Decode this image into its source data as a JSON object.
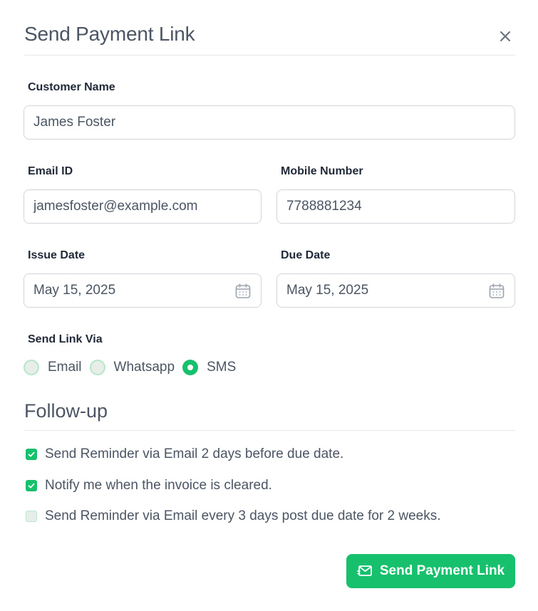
{
  "modal": {
    "title": "Send Payment Link",
    "close_icon": "close-icon"
  },
  "form": {
    "customer_name": {
      "label": "Customer Name",
      "value": "James Foster"
    },
    "email": {
      "label": "Email ID",
      "value": "jamesfoster@example.com"
    },
    "mobile": {
      "label": "Mobile Number",
      "value": "7788881234"
    },
    "issue_date": {
      "label": "Issue Date",
      "value": "May 15, 2025",
      "icon": "calendar-icon"
    },
    "due_date": {
      "label": "Due Date",
      "value": "May 15, 2025",
      "icon": "calendar-icon"
    },
    "send_via": {
      "label": "Send Link Via",
      "options": [
        "Email",
        "Whatsapp",
        "SMS"
      ],
      "selected": "SMS"
    }
  },
  "followup": {
    "title": "Follow-up",
    "items": [
      {
        "label": "Send Reminder via Email 2 days before due date.",
        "checked": true
      },
      {
        "label": "Notify me when the invoice is cleared.",
        "checked": true
      },
      {
        "label": "Send Reminder via Email every 3 days post due date for 2 weeks.",
        "checked": false
      }
    ]
  },
  "actions": {
    "send_label": "Send Payment Link",
    "send_icon": "mail-icon"
  },
  "colors": {
    "accent": "#17c06c",
    "text": "#4b5563",
    "border": "#d1d5db"
  }
}
